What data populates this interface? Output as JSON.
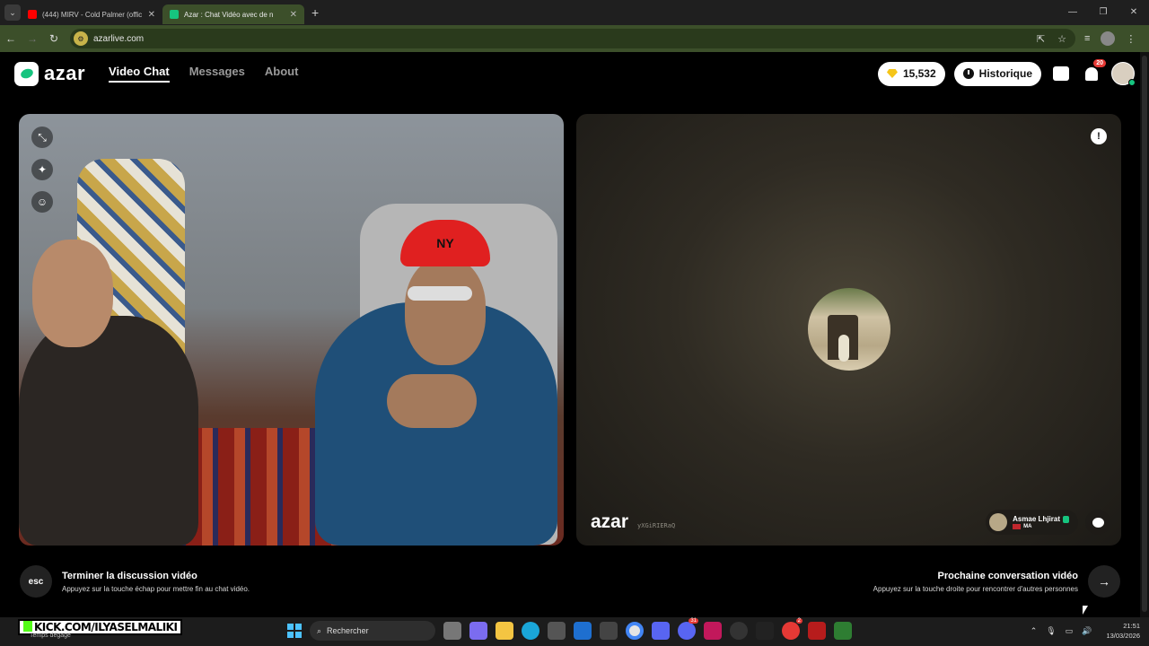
{
  "browser": {
    "tabs": [
      {
        "title": "(444) MIRV - Cold Palmer (offic",
        "favicon_color": "#ff0000",
        "active": false
      },
      {
        "title": "Azar : Chat Vidéo avec de n",
        "favicon_color": "#16c47f",
        "active": true
      }
    ],
    "url": "azarlive.com"
  },
  "app": {
    "logo": "azar",
    "nav": [
      "Video Chat",
      "Messages",
      "About"
    ],
    "active_nav": "Video Chat",
    "gems": "15,532",
    "history_label": "Historique",
    "notification_count": "20",
    "accent_color": "#16c47f"
  },
  "local_video": {
    "cap_text": "NY"
  },
  "remote_video": {
    "logo": "azar",
    "session_id": "yXGiRIERaQ",
    "peer_name": "Asmae Lhjirat",
    "peer_country": "MA"
  },
  "hints": {
    "end_key": "esc",
    "end_title": "Terminer la discussion vidéo",
    "end_sub": "Appuyez sur la touche échap pour mettre fin au chat vidéo.",
    "next_title": "Prochaine conversation vidéo",
    "next_sub": "Appuyez sur la touche droite pour rencontrer d'autres personnes",
    "next_icon": "→"
  },
  "taskbar": {
    "overlay_text": "KICK.COM/ILYASELMALIKI",
    "weather": "Temps dégagé",
    "search_placeholder": "Rechercher",
    "time": "21:51",
    "date": "13/03/2026"
  }
}
